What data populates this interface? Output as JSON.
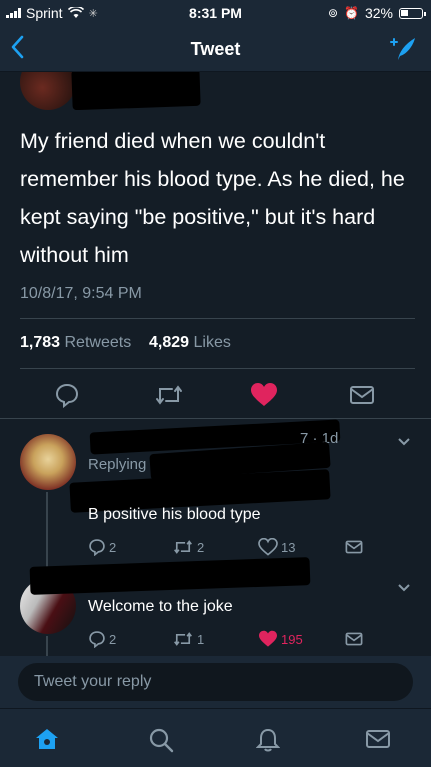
{
  "status_bar": {
    "carrier": "Sprint",
    "time": "8:31 PM",
    "battery_percent": "32%"
  },
  "nav": {
    "title": "Tweet"
  },
  "tweet": {
    "text": "My friend died when we couldn't remember his blood type. As he died, he kept saying \"be positive,\" but it's hard without him",
    "timestamp": "10/8/17, 9:54 PM",
    "retweets_count": "1,783",
    "retweets_label": "Retweets",
    "likes_count": "4,829",
    "likes_label": "Likes"
  },
  "replies": [
    {
      "meta_suffix": "7 · 1d",
      "replying_prefix": "Replying t",
      "text": "B positive his blood type",
      "reply_count": "2",
      "retweet_count": "2",
      "like_count": "13",
      "liked": false
    },
    {
      "text": "Welcome to the joke",
      "reply_count": "2",
      "retweet_count": "1",
      "like_count": "195",
      "liked": true
    }
  ],
  "reply_bar": {
    "placeholder": "Tweet your reply"
  },
  "colors": {
    "accent": "#1da1f2",
    "like": "#e0245e",
    "background": "#141d26",
    "muted": "#8899a6"
  },
  "icons": [
    "back-icon",
    "compose-icon",
    "reply-icon",
    "retweet-icon",
    "heart-icon",
    "message-icon",
    "chevron-down-icon",
    "home-icon",
    "search-icon",
    "notifications-icon"
  ]
}
